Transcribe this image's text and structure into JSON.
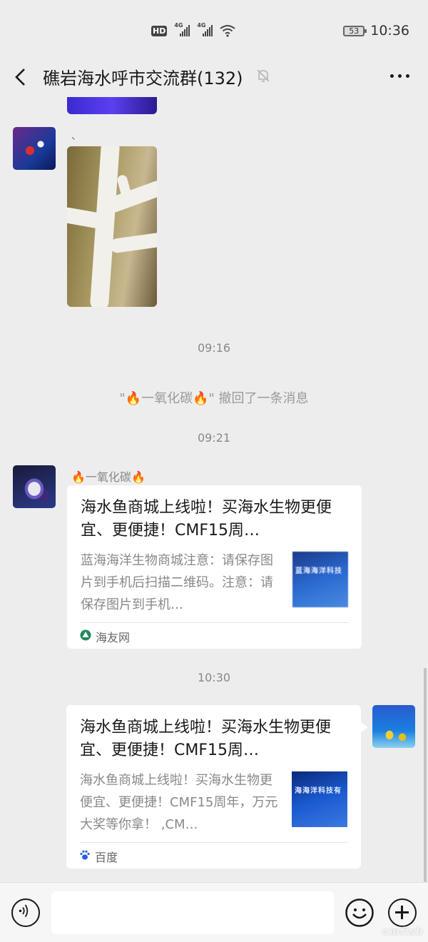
{
  "status_bar": {
    "hd": "HD",
    "network_a": "4G",
    "network_b": "4G",
    "battery": "53",
    "time": "10:36"
  },
  "header": {
    "title": "礁岩海水呼市交流群(132)"
  },
  "messages": {
    "photo_caption": "、",
    "time_1": "09:16",
    "recall": {
      "quote_open": "\"",
      "flame_left": "🔥",
      "name": "一氧化碳",
      "flame_right": "🔥",
      "quote_close": "\"",
      "text": " 撤回了一条消息"
    },
    "time_2": "09:21",
    "sender": {
      "flame_left": "🔥",
      "name": "一氧化碳",
      "flame_right": "🔥"
    },
    "card_1": {
      "title": "海水鱼商城上线啦！买海水生物更便宜、更便捷！CMF15周…",
      "description": "蓝海海洋生物商城注意：请保存图片到手机后扫描二维码。注意：请保存图片到手机…",
      "thumb_text": "蓝海海洋科技",
      "source": "海友网"
    },
    "time_3": "10:30",
    "card_2": {
      "title": "海水鱼商城上线啦！买海水生物更便宜、更便捷！CMF15周…",
      "description": " 海水鱼商城上线啦！买海水生物更便宜、更便捷！CMF15周年，万元大奖等你拿！ ,CM…",
      "thumb_text": "海海洋科技有",
      "source": "百度"
    }
  },
  "input_bar": {
    "watermark": "cmfish"
  },
  "colors": {
    "background": "#ededed",
    "card": "#ffffff",
    "meta_text": "#888888",
    "haiyou_green": "#1f8a5a",
    "baidu_blue": "#2b5fd9"
  }
}
